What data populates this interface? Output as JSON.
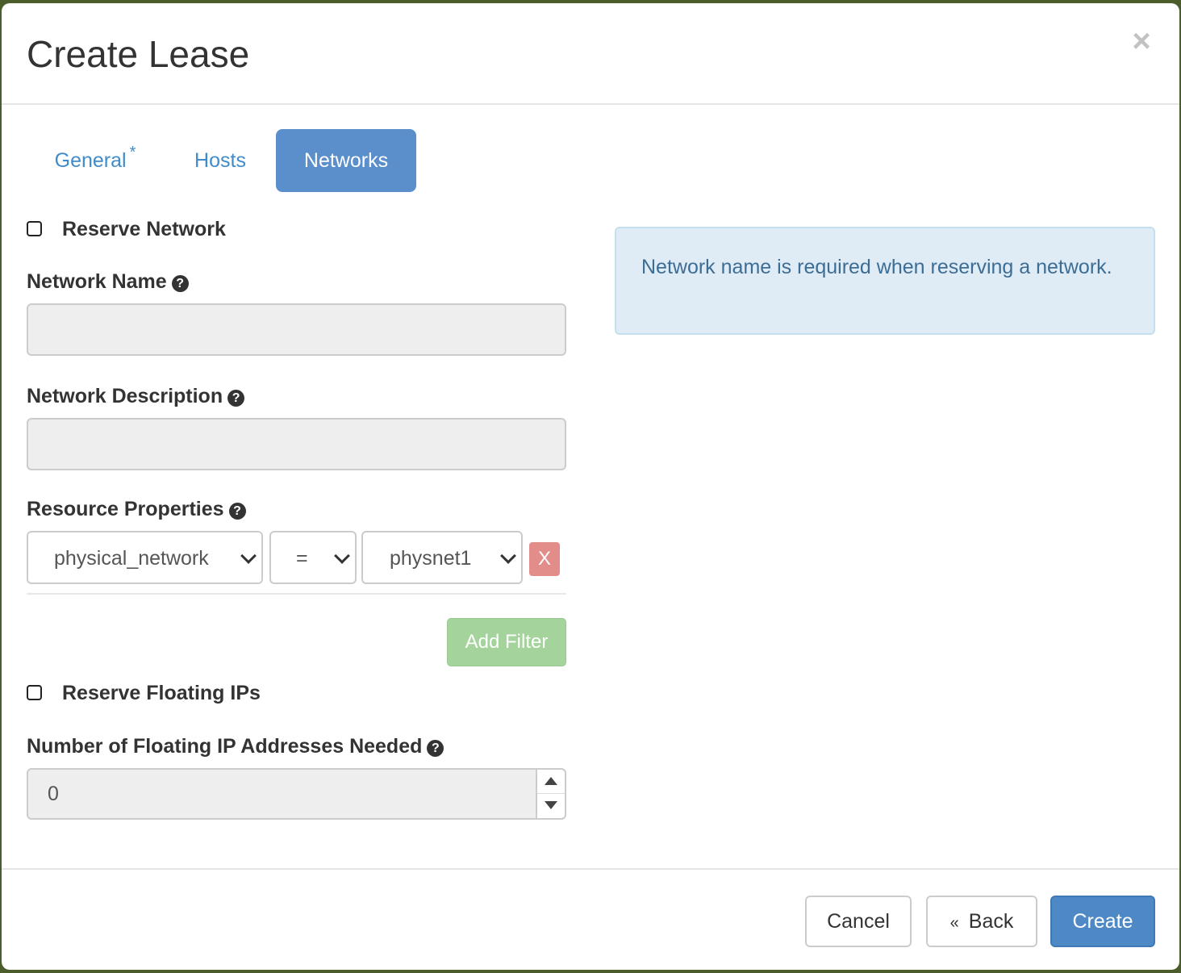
{
  "dialog": {
    "title": "Create Lease",
    "close_icon": "×"
  },
  "tabs": [
    {
      "label": "General",
      "required_mark": "*",
      "active": false
    },
    {
      "label": "Hosts",
      "active": false
    },
    {
      "label": "Networks",
      "active": true
    }
  ],
  "form": {
    "reserve_network": {
      "label": "Reserve Network",
      "checked": false
    },
    "network_name": {
      "label": "Network Name",
      "value": "",
      "help_icon": "question-circle-icon"
    },
    "network_description": {
      "label": "Network Description",
      "value": "",
      "help_icon": "question-circle-icon"
    },
    "resource_properties": {
      "label": "Resource Properties",
      "property_select": {
        "value": "physical_network"
      },
      "operator_select": {
        "value": "="
      },
      "value_select": {
        "value": "physnet1"
      },
      "remove_label": "X",
      "add_filter_label": "Add Filter"
    },
    "reserve_floating_ips": {
      "label": "Reserve Floating IPs",
      "checked": false
    },
    "floating_ip_count": {
      "label": "Number of Floating IP Addresses Needed",
      "value": "0"
    }
  },
  "info_message": "Network name is required when reserving a network.",
  "footer": {
    "cancel_label": "Cancel",
    "back_arrow": "«",
    "back_label": "Back",
    "create_label": "Create"
  },
  "colors": {
    "primary": "#4e89c6",
    "active_tab": "#5b8fcb",
    "link": "#428bca",
    "danger": "#e38d8a",
    "success_disabled": "#a5d39c",
    "info_bg": "#dfecf6",
    "info_text": "#3d6d94"
  }
}
